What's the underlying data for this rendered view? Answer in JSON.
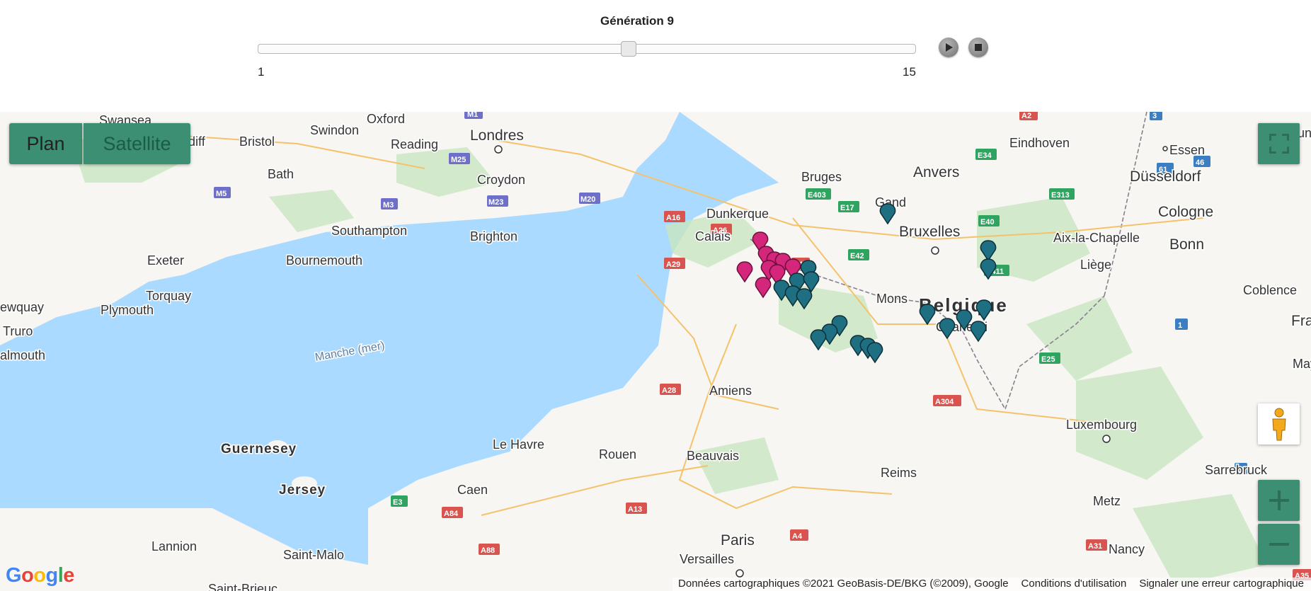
{
  "header": {
    "title": "Génération 9",
    "slider": {
      "min_label": "1",
      "max_label": "15",
      "value": 9,
      "min": 1,
      "max": 15
    },
    "play_icon": "play-icon",
    "stop_icon": "stop-icon"
  },
  "map": {
    "type_buttons": {
      "plan": "Plan",
      "satellite": "Satellite",
      "active": "Plan"
    },
    "controls": {
      "fullscreen": "fullscreen-icon",
      "pegman": "pegman-icon",
      "zoom_in": "plus-icon",
      "zoom_out": "minus-icon"
    },
    "logo": "Google",
    "attribution": {
      "data": "Données cartographiques ©2021 GeoBasis-DE/BKG (©2009), Google",
      "terms": "Conditions d'utilisation",
      "report": "Signaler une erreur cartographique"
    },
    "colors": {
      "sea": "#aadaff",
      "land": "#f7f6f2",
      "forest": "#c8e6c0",
      "marker_teal": "#1f6f82",
      "marker_magenta": "#d4267a",
      "button": "#3d8f73"
    },
    "places": {
      "swansea": "Swansea",
      "cardiff": "ardiff",
      "bristol": "Bristol",
      "bath": "Bath",
      "swindon": "Swindon",
      "oxford": "Oxford",
      "reading": "Reading",
      "londres": "Londres",
      "croydon": "Croydon",
      "southampton": "Southampton",
      "brighton": "Brighton",
      "bournemouth": "Bournemouth",
      "exeter": "Exeter",
      "torquay": "Torquay",
      "plymouth": "Plymouth",
      "newquay": "ewquay",
      "truro": "Truro",
      "falmouth": "almouth",
      "manche": "Manche (mer)",
      "guernesey": "Guernesey",
      "jersey": "Jersey",
      "lannion": "Lannion",
      "saint_malo": "Saint-Malo",
      "saint_brieuc": "Saint-Brieuc",
      "caen": "Caen",
      "le_havre": "Le Havre",
      "rouen": "Rouen",
      "beauvais": "Beauvais",
      "amiens": "Amiens",
      "paris": "Paris",
      "versailles": "Versailles",
      "reims": "Reims",
      "calais": "Calais",
      "dunkerque": "Dunkerque",
      "bruges": "Bruges",
      "gand": "Gand",
      "anvers": "Anvers",
      "bruxelles": "Bruxelles",
      "mons": "Mons",
      "charleroi": "Charleroi",
      "belgique": "Belgique",
      "liege": "Liège",
      "aix": "Aix-la-Chapelle",
      "eindhoven": "Eindhoven",
      "essen": "Essen",
      "dortmund": "Dortmun",
      "dusseldorf": "Düsseldorf",
      "cologne": "Cologne",
      "bonn": "Bonn",
      "coblence": "Coblence",
      "france": "Franc",
      "mayence": "May",
      "luxembourg": "Luxembourg",
      "sarrebruck": "Sarrebruck",
      "metz": "Metz",
      "nancy": "Nancy"
    },
    "roads": [
      "M1",
      "M25",
      "M23",
      "M20",
      "M5",
      "M3",
      "A16",
      "A26",
      "E403",
      "E17",
      "E40",
      "E313",
      "E34",
      "A2",
      "E42",
      "A1",
      "E411",
      "A304",
      "E25",
      "A28",
      "A29",
      "E3",
      "A84",
      "A88",
      "A13",
      "A4",
      "A31",
      "A35",
      "61",
      "46",
      "3",
      "1",
      "6",
      "5"
    ]
  }
}
